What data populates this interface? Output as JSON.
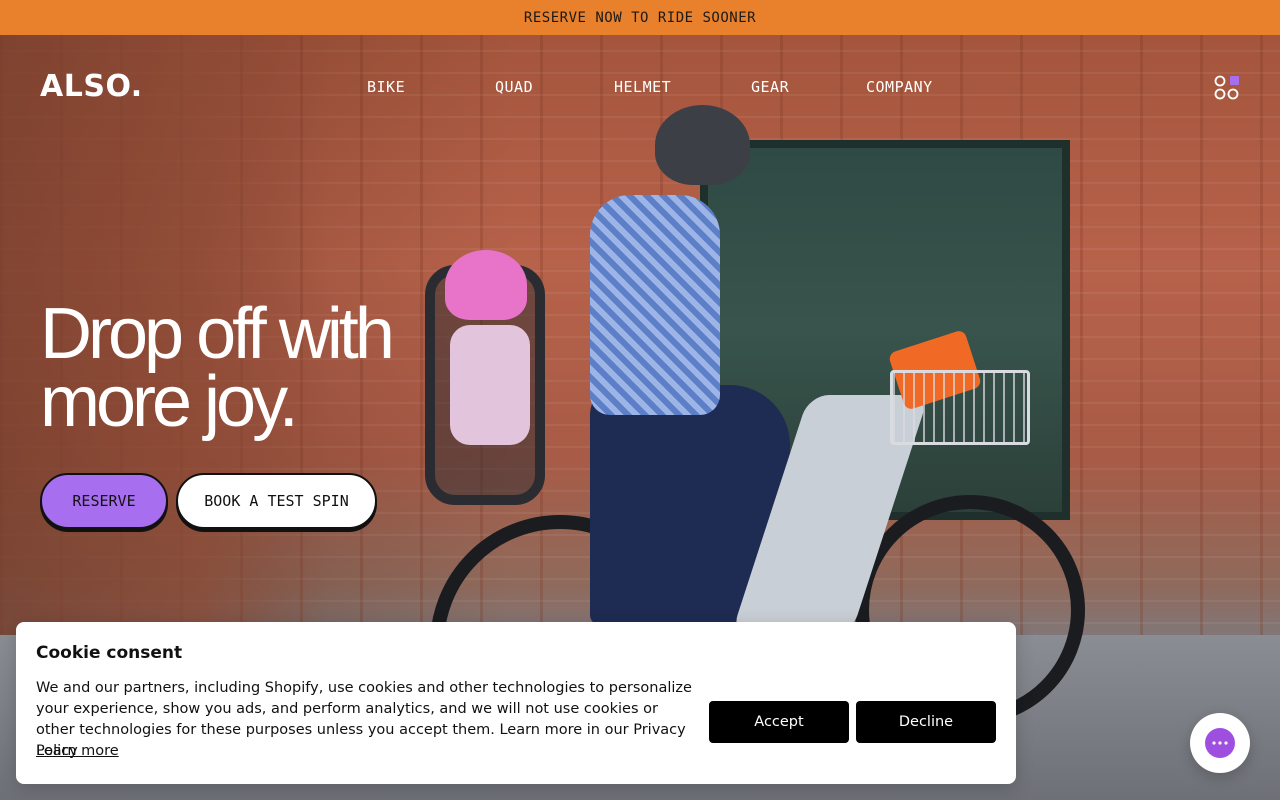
{
  "announcement": {
    "text": "RESERVE NOW TO RIDE SOONER"
  },
  "header": {
    "logo": "ALSO.",
    "nav": [
      "BIKE",
      "QUAD",
      "HELMET",
      "GEAR",
      "COMPANY"
    ],
    "menu_icon": "app-grid-icon"
  },
  "hero": {
    "headline_line1": "Drop off with",
    "headline_line2": "more joy.",
    "reserve_label": "RESERVE",
    "test_spin_label": "BOOK A TEST SPIN",
    "image_description_icon": "photo-icon"
  },
  "cookie": {
    "title": "Cookie consent",
    "body": "We and our partners, including Shopify, use cookies and other technologies to personalize your experience, show you ads, and perform analytics, and we will not use cookies or other technologies for these purposes unless you accept them. Learn more in our Privacy Policy",
    "learn_more": "Learn more",
    "accept_label": "Accept",
    "decline_label": "Decline"
  },
  "chat": {
    "icon": "chat-icon"
  },
  "colors": {
    "announcement_bg": "#e8802c",
    "reserve_button": "#a86ef0",
    "chat_accent": "#9f4fe0",
    "menu_dot_accent": "#a86ef0"
  }
}
